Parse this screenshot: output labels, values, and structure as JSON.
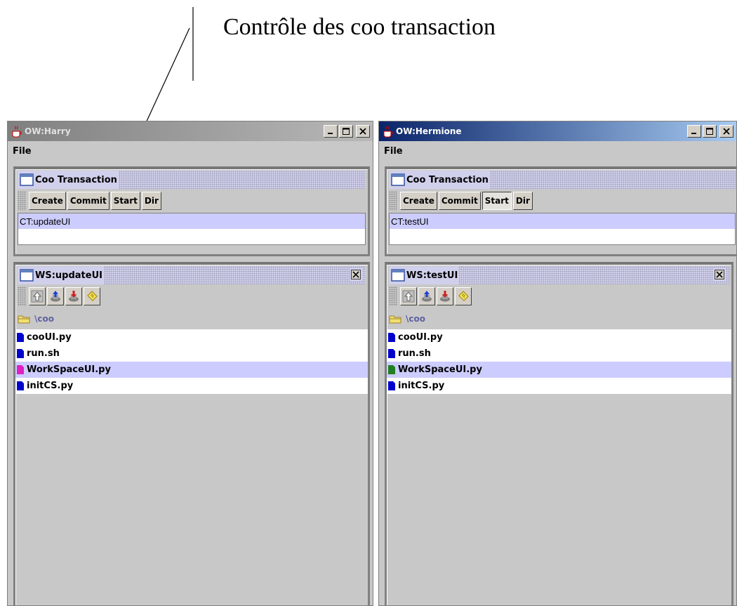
{
  "annotation": {
    "text": "Contrôle des coo transaction"
  },
  "windows": [
    {
      "title": "OW:Harry",
      "active": false,
      "menu": [
        "File"
      ],
      "transaction_frame": {
        "title": "Coo Transaction",
        "buttons": [
          "Create",
          "Commit",
          "Start",
          "Dir"
        ],
        "pressed_button": "",
        "items": [
          "CT:updateUI"
        ]
      },
      "workspace_frame": {
        "title": "WS:updateUI",
        "tool_icons": [
          "up-arrow-icon",
          "checkin-icon",
          "checkout-icon",
          "notes-icon"
        ],
        "path": "\\coo",
        "files": [
          {
            "name": "cooUI.py",
            "color": "#0000cc",
            "selected": false
          },
          {
            "name": "run.sh",
            "color": "#0000cc",
            "selected": false
          },
          {
            "name": "WorkSpaceUI.py",
            "color": "#e020c0",
            "selected": true
          },
          {
            "name": "initCS.py",
            "color": "#0000cc",
            "selected": false
          }
        ]
      }
    },
    {
      "title": "OW:Hermione",
      "active": true,
      "menu": [
        "File"
      ],
      "transaction_frame": {
        "title": "Coo Transaction",
        "buttons": [
          "Create",
          "Commit",
          "Start",
          "Dir"
        ],
        "pressed_button": "Start",
        "items": [
          "CT:testUI"
        ]
      },
      "workspace_frame": {
        "title": "WS:testUI",
        "tool_icons": [
          "up-arrow-icon",
          "checkin-icon",
          "checkout-icon",
          "notes-icon"
        ],
        "path": "\\coo",
        "files": [
          {
            "name": "cooUI.py",
            "color": "#0000cc",
            "selected": false
          },
          {
            "name": "run.sh",
            "color": "#0000cc",
            "selected": false
          },
          {
            "name": "WorkSpaceUI.py",
            "color": "#208020",
            "selected": true
          },
          {
            "name": "initCS.py",
            "color": "#0000cc",
            "selected": false
          }
        ]
      }
    }
  ]
}
